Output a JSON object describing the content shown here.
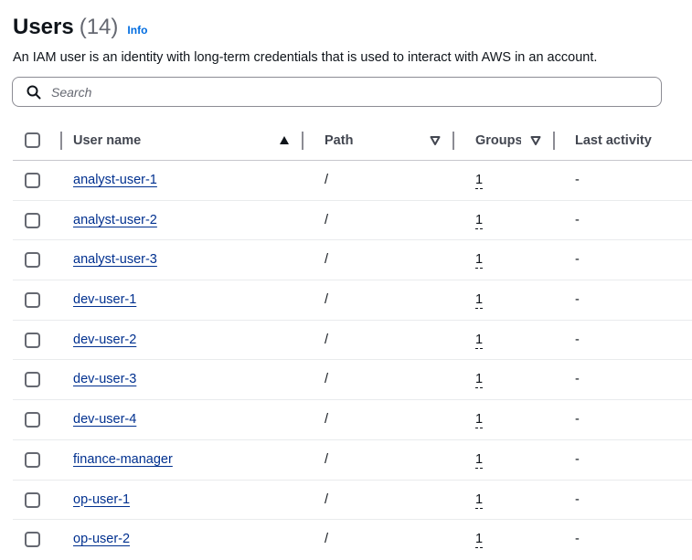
{
  "header": {
    "title": "Users",
    "count": "(14)",
    "info_label": "Info"
  },
  "description": "An IAM user is an identity with long-term credentials that is used to interact with AWS in an account.",
  "search": {
    "placeholder": "Search",
    "value": ""
  },
  "columns": {
    "user_name": "User name",
    "path": "Path",
    "groups": "Groups",
    "last_activity": "Last activity"
  },
  "rows": [
    {
      "user_name": "analyst-user-1",
      "path": "/",
      "groups": "1",
      "last_activity": "-"
    },
    {
      "user_name": "analyst-user-2",
      "path": "/",
      "groups": "1",
      "last_activity": "-"
    },
    {
      "user_name": "analyst-user-3",
      "path": "/",
      "groups": "1",
      "last_activity": "-"
    },
    {
      "user_name": "dev-user-1",
      "path": "/",
      "groups": "1",
      "last_activity": "-"
    },
    {
      "user_name": "dev-user-2",
      "path": "/",
      "groups": "1",
      "last_activity": "-"
    },
    {
      "user_name": "dev-user-3",
      "path": "/",
      "groups": "1",
      "last_activity": "-"
    },
    {
      "user_name": "dev-user-4",
      "path": "/",
      "groups": "1",
      "last_activity": "-"
    },
    {
      "user_name": "finance-manager",
      "path": "/",
      "groups": "1",
      "last_activity": "-"
    },
    {
      "user_name": "op-user-1",
      "path": "/",
      "groups": "1",
      "last_activity": "-"
    },
    {
      "user_name": "op-user-2",
      "path": "/",
      "groups": "1",
      "last_activity": "-"
    }
  ],
  "colors": {
    "link": "#00308f",
    "info_link": "#006ce0",
    "text": "#0f141a",
    "muted": "#656871"
  },
  "icons": {
    "search": "search-icon",
    "sort_asc": "sort-ascending-icon",
    "sort_desc": "sort-descending-icon"
  }
}
